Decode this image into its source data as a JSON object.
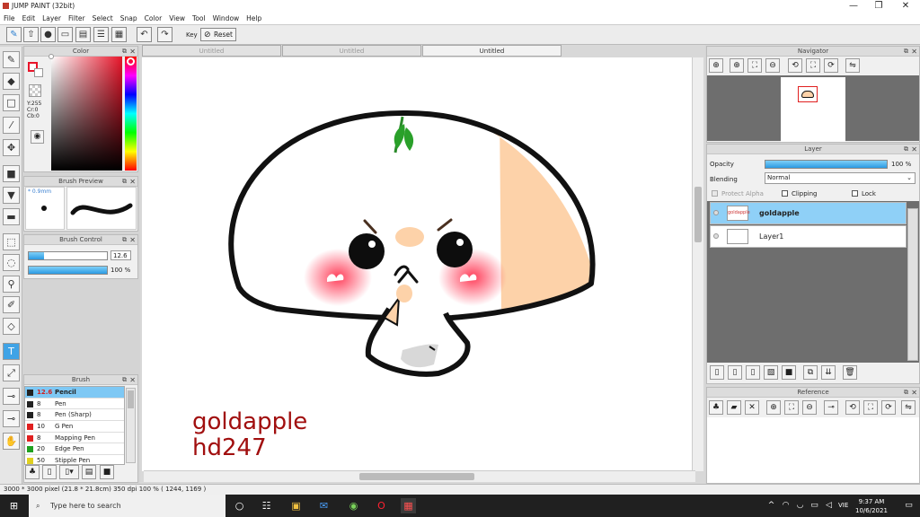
{
  "window": {
    "title": "JUMP PAINT (32bit)",
    "minimize": "—",
    "restore": "❐",
    "close": "✕"
  },
  "menu": [
    "File",
    "Edit",
    "Layer",
    "Filter",
    "Select",
    "Snap",
    "Color",
    "View",
    "Tool",
    "Window",
    "Help"
  ],
  "toolbar": {
    "icons": [
      "pen-tool-icon",
      "share-icon",
      "comment-icon",
      "chat-icon",
      "document-icon",
      "layout-icon",
      "grid-icon"
    ],
    "undo": "↶",
    "redo": "↷",
    "key_label": "Key",
    "reset_label": "Reset"
  },
  "color_panel": {
    "title": "Color",
    "values": [
      "Y:255",
      "Cr:0",
      "Cb:0"
    ],
    "primary_color": "#ffffff",
    "secondary_color": "#e8152a"
  },
  "brush_preview": {
    "title": "Brush Preview",
    "size": "0.9mm"
  },
  "brush_control": {
    "title": "Brush Control",
    "size_value": "12.6",
    "size_fraction": 0.2,
    "opacity_value": "100 %",
    "opacity_fraction": 1.0
  },
  "brush": {
    "title": "Brush",
    "items": [
      {
        "size": "12.6",
        "name": "Pencil",
        "color": "#222222",
        "selected": true
      },
      {
        "size": "8",
        "name": "Pen",
        "color": "#222222",
        "selected": false
      },
      {
        "size": "8",
        "name": "Pen (Sharp)",
        "color": "#222222",
        "selected": false
      },
      {
        "size": "10",
        "name": "G Pen",
        "color": "#e02020",
        "selected": false
      },
      {
        "size": "8",
        "name": "Mapping Pen",
        "color": "#e02020",
        "selected": false
      },
      {
        "size": "20",
        "name": "Edge Pen",
        "color": "#20a020",
        "selected": false
      },
      {
        "size": "50",
        "name": "Stipple Pen",
        "color": "#e0d020",
        "selected": false
      }
    ]
  },
  "canvas": {
    "tabs": [
      "Untitled",
      "Untitled",
      "Untitled"
    ],
    "active_tab": 2,
    "signature": [
      "goldapple",
      "hd247"
    ]
  },
  "navigator": {
    "title": "Navigator"
  },
  "layer_panel": {
    "title": "Layer",
    "opacity_label": "Opacity",
    "opacity_value": "100 %",
    "opacity_fraction": 1.0,
    "blending_label": "Blending",
    "blending_value": "Normal",
    "protect_alpha": "Protect Alpha",
    "clipping": "Clipping",
    "lock": "Lock",
    "layers": [
      {
        "name": "goldapple",
        "thumb": "goldapple",
        "selected": true
      },
      {
        "name": "Layer1",
        "thumb": "",
        "selected": false
      }
    ]
  },
  "reference": {
    "title": "Reference"
  },
  "status": {
    "text": "3000 * 3000 pixel  (21.8 * 21.8cm)  350 dpi  100 %  ( 1244, 1169 )"
  },
  "taskbar": {
    "search_placeholder": "Type here to search",
    "time": "9:37 AM",
    "date": "10/6/2021",
    "lang": "VIE"
  }
}
